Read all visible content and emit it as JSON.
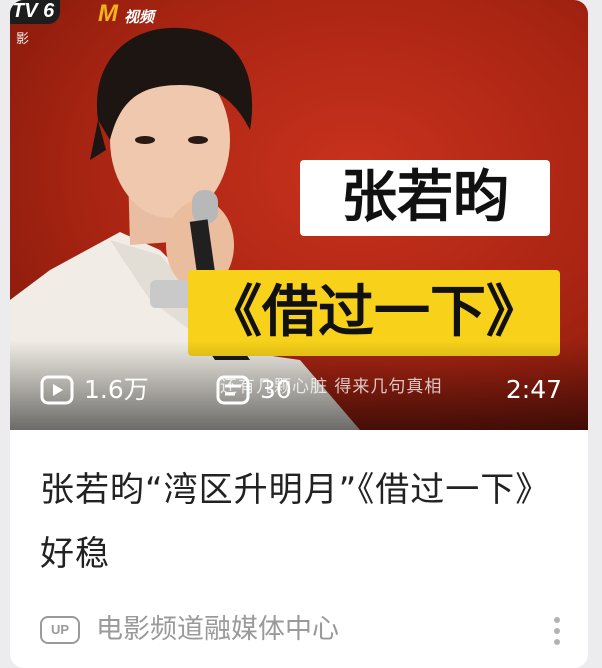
{
  "video_card": {
    "thumbnail": {
      "channel_logo": "TV 6",
      "channel_logo_sub": "影",
      "platform_logo": "M",
      "platform_logo_text": "视频",
      "overlay_name": "张若昀",
      "overlay_song": "《借过一下》",
      "lyrics_subtitle": "还有几颗心脏 得来几句真相",
      "play_count": "1.6万",
      "danmaku_count": "30",
      "duration": "2:47"
    },
    "title": "张若昀“湾区升明月”《借过一下》好稳",
    "author_badge": "UP",
    "author": "电影频道融媒体中心"
  },
  "icons": {
    "play_count": "play-icon",
    "danmaku": "danmaku-icon",
    "more": "more-vertical-icon"
  },
  "colors": {
    "thumbnail_bg": "#a82412",
    "overlay_song_bg": "#f8d21a",
    "overlay_name_bg": "#ffffff",
    "secondary_text": "#9a9a9a"
  }
}
